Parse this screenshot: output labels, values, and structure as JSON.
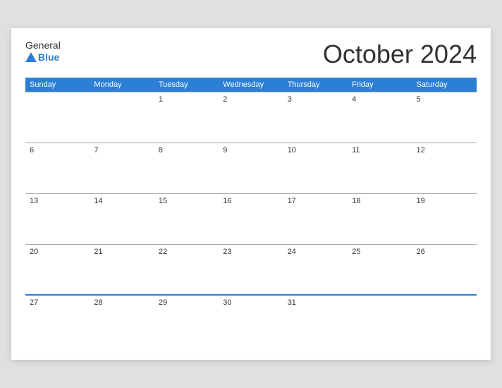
{
  "logo": {
    "general_text": "General",
    "blue_text": "Blue"
  },
  "header": {
    "title": "October 2024"
  },
  "weekdays": [
    "Sunday",
    "Monday",
    "Tuesday",
    "Wednesday",
    "Thursday",
    "Friday",
    "Saturday"
  ],
  "weeks": [
    [
      {
        "day": "",
        "empty": true
      },
      {
        "day": "",
        "empty": true
      },
      {
        "day": "1",
        "empty": false
      },
      {
        "day": "2",
        "empty": false
      },
      {
        "day": "3",
        "empty": false
      },
      {
        "day": "4",
        "empty": false
      },
      {
        "day": "5",
        "empty": false
      }
    ],
    [
      {
        "day": "6",
        "empty": false
      },
      {
        "day": "7",
        "empty": false
      },
      {
        "day": "8",
        "empty": false
      },
      {
        "day": "9",
        "empty": false
      },
      {
        "day": "10",
        "empty": false
      },
      {
        "day": "11",
        "empty": false
      },
      {
        "day": "12",
        "empty": false
      }
    ],
    [
      {
        "day": "13",
        "empty": false
      },
      {
        "day": "14",
        "empty": false
      },
      {
        "day": "15",
        "empty": false
      },
      {
        "day": "16",
        "empty": false
      },
      {
        "day": "17",
        "empty": false
      },
      {
        "day": "18",
        "empty": false
      },
      {
        "day": "19",
        "empty": false
      }
    ],
    [
      {
        "day": "20",
        "empty": false
      },
      {
        "day": "21",
        "empty": false
      },
      {
        "day": "22",
        "empty": false
      },
      {
        "day": "23",
        "empty": false
      },
      {
        "day": "24",
        "empty": false
      },
      {
        "day": "25",
        "empty": false
      },
      {
        "day": "26",
        "empty": false
      }
    ],
    [
      {
        "day": "27",
        "empty": false
      },
      {
        "day": "28",
        "empty": false
      },
      {
        "day": "29",
        "empty": false
      },
      {
        "day": "30",
        "empty": false
      },
      {
        "day": "31",
        "empty": false
      },
      {
        "day": "",
        "empty": true
      },
      {
        "day": "",
        "empty": true
      }
    ]
  ]
}
